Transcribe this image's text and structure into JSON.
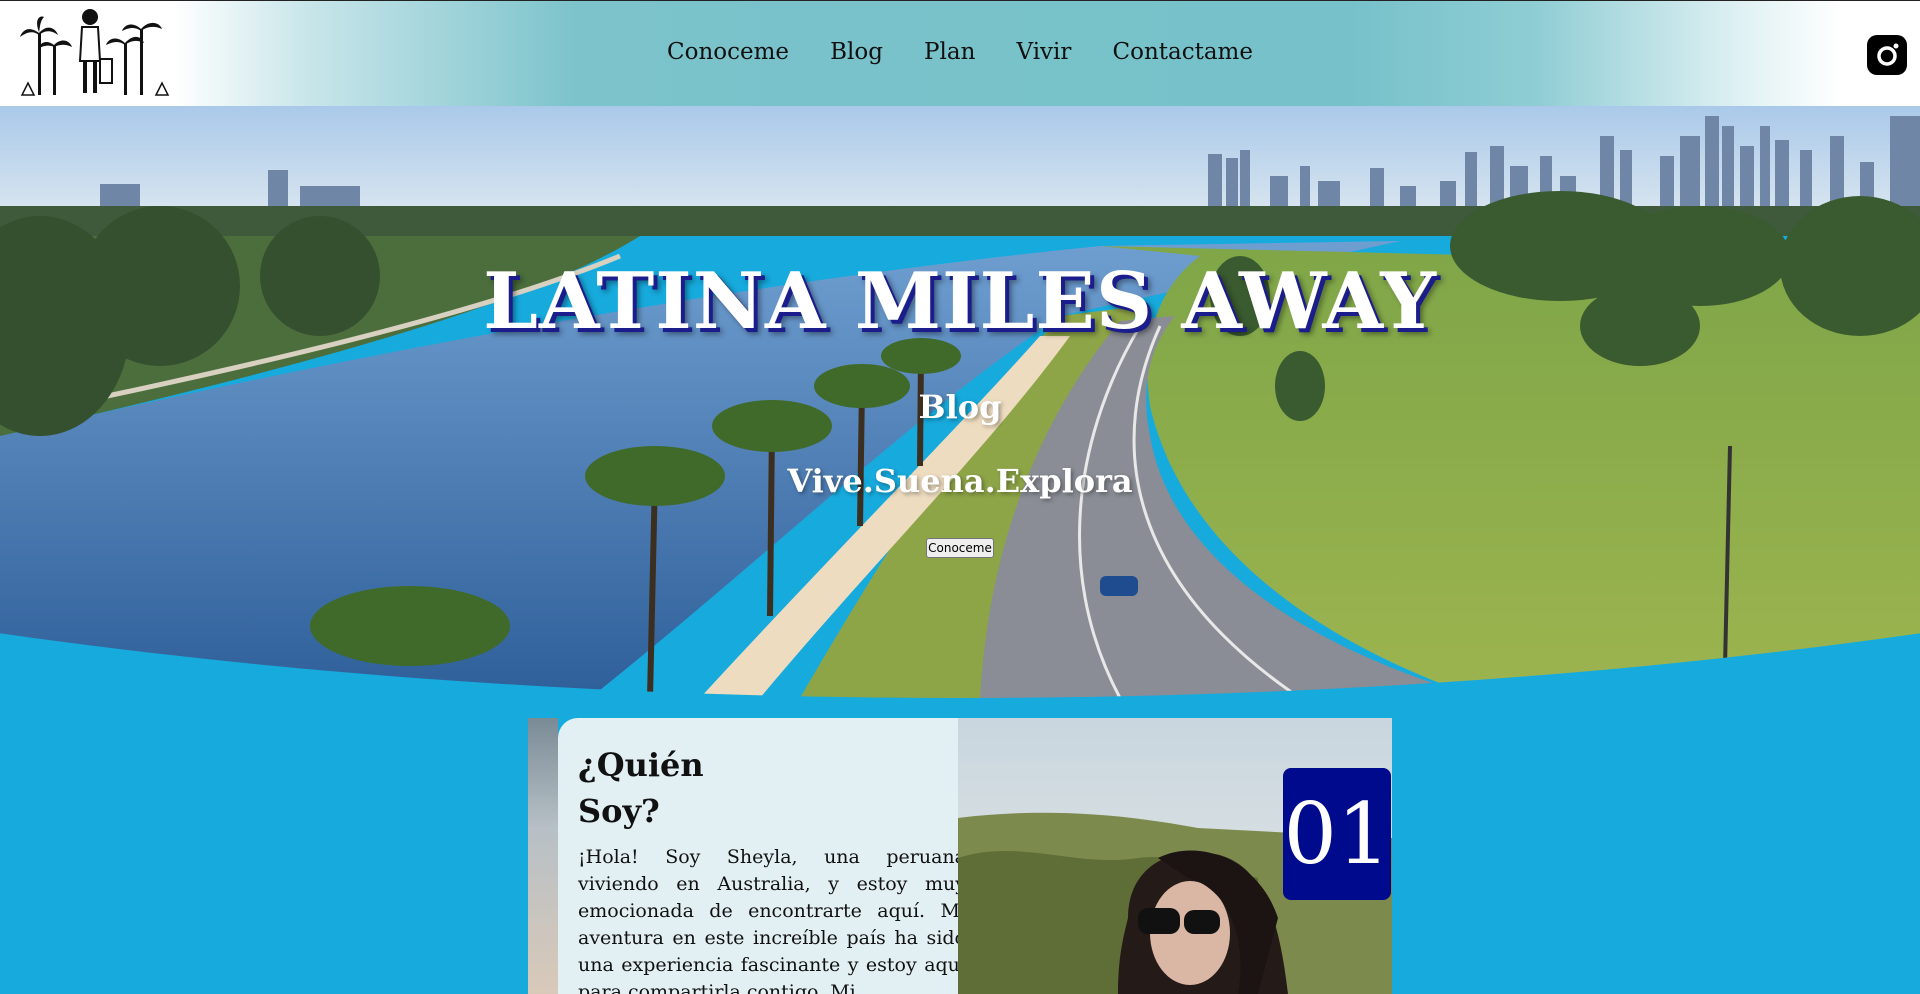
{
  "header": {
    "nav": [
      "Conoceme",
      "Blog",
      "Plan",
      "Vivir",
      "Contactame"
    ],
    "social_icon": "instagram-icon"
  },
  "hero": {
    "title": "LATINA MILES AWAY",
    "subtitle": "Blog",
    "tagline": "Vive.Suena.Explora",
    "button_label": "Conoceme"
  },
  "about": {
    "title": "¿Quién Soy?",
    "body": "¡Hola! Soy Sheyla, una peruana viviendo en Australia, y estoy muy emocionada de encontrarte aquí. Mi aventura en este increíble país ha sido una experiencia fascinante y estoy aquí para compartirla contigo. Mi",
    "badge": "01"
  },
  "colors": {
    "page_bg": "#17aadd",
    "header_teal": "#76c1ca",
    "badge_bg": "#000a8c",
    "card_bg": "#e2eff3"
  }
}
